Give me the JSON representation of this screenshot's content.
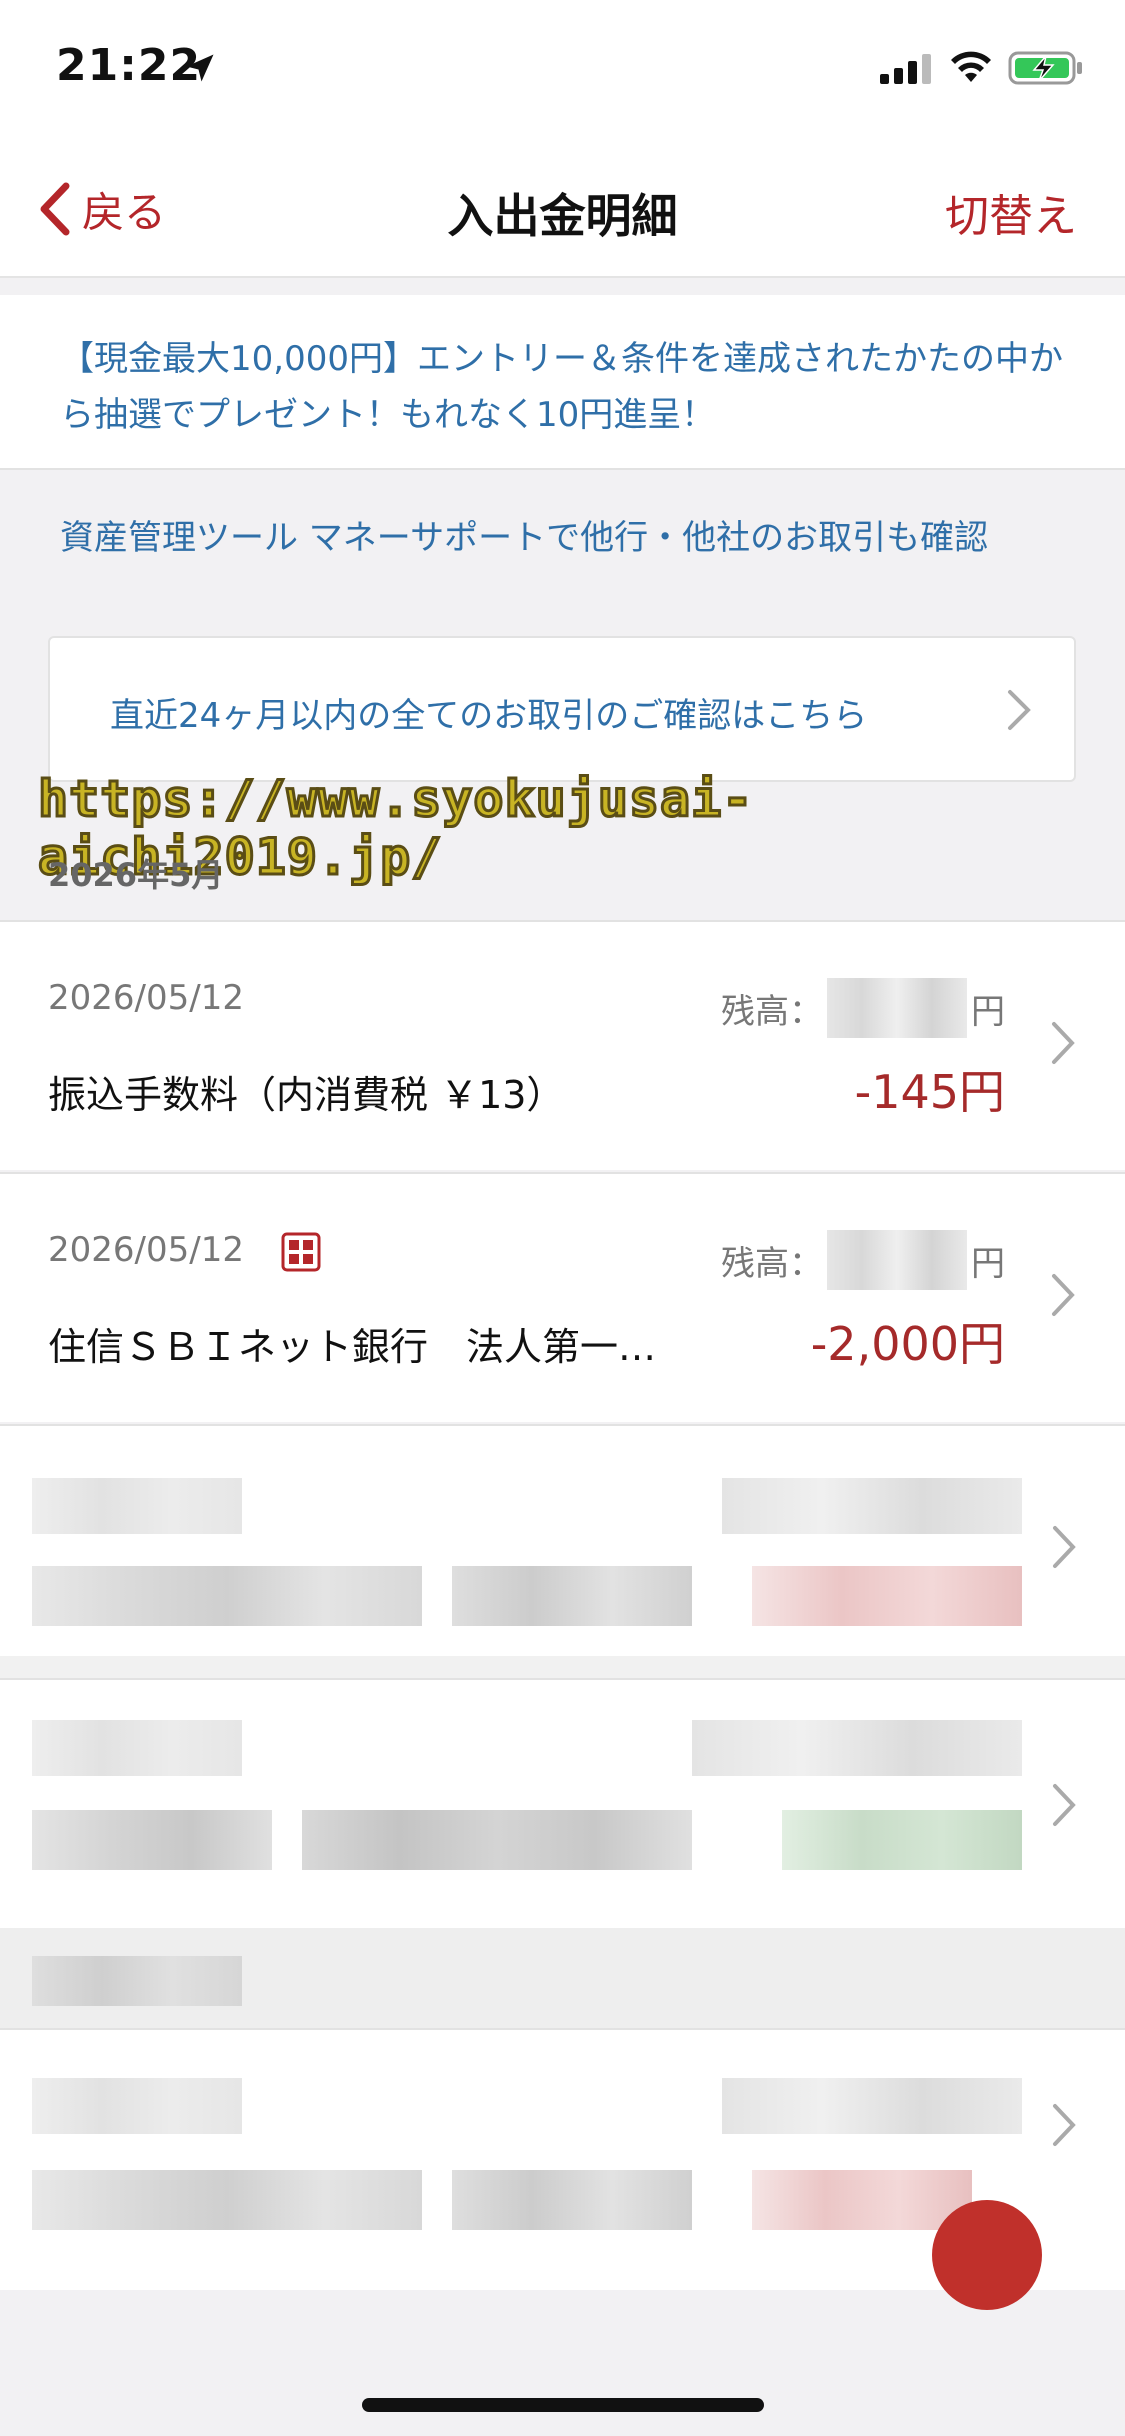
{
  "status_bar": {
    "time": "21:22"
  },
  "nav": {
    "back_label": "戻る",
    "title": "入出金明細",
    "switch_label": "切替え"
  },
  "promo": {
    "text": "【現金最大10,000円】エントリー＆条件を達成されたかたの中から抽選でプレゼント！もれなく10円進呈！"
  },
  "tool_link": {
    "text": "資産管理ツール マネーサポートで他行・他社のお取引も確認"
  },
  "confirm_link": {
    "text": "直近24ヶ月以内の全てのお取引のご確認はこちら"
  },
  "watermark": {
    "text": "https://www.syokujusai-aichi2019.jp/"
  },
  "month_header": {
    "label": "2026年5月"
  },
  "transactions": [
    {
      "date": "2026/05/12",
      "balance_label": "残高：",
      "balance_unit": "円",
      "description": "振込手数料（内消費税 ￥13）",
      "amount": "-145円"
    },
    {
      "date": "2026/05/12",
      "balance_label": "残高：",
      "balance_unit": "円",
      "description": "住信ＳＢＩネット銀行　法人第一…",
      "amount": "-2,000円"
    }
  ],
  "colors": {
    "accent": "#b4262a",
    "link": "#2f6fa8",
    "amount": "#a52a2a"
  }
}
